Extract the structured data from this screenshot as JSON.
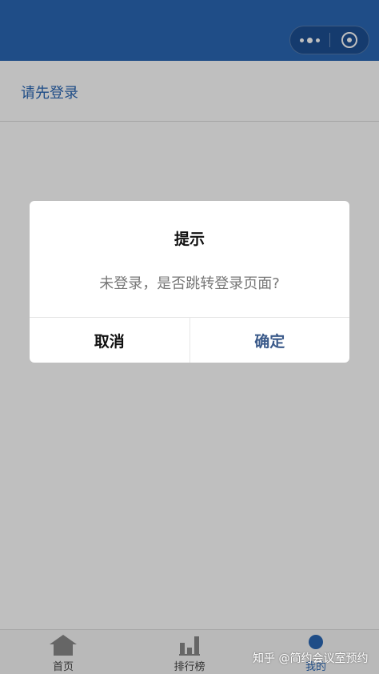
{
  "colors": {
    "navbar": "#2a67b4",
    "accent": "#2a67b4",
    "confirm": "#3b5a8a"
  },
  "navbar": {
    "capsule_icons": [
      "more-dots-icon",
      "close-target-icon"
    ]
  },
  "page": {
    "login_prompt": "请先登录"
  },
  "modal": {
    "title": "提示",
    "message": "未登录，是否跳转登录页面?",
    "cancel_label": "取消",
    "confirm_label": "确定"
  },
  "tabbar": {
    "items": [
      {
        "label": "首页",
        "icon": "home-icon"
      },
      {
        "label": "排行榜",
        "icon": "bar-chart-icon"
      },
      {
        "label": "我的",
        "icon": "user-icon",
        "active": true
      }
    ]
  },
  "watermark": "知乎 @简约会议室预约"
}
